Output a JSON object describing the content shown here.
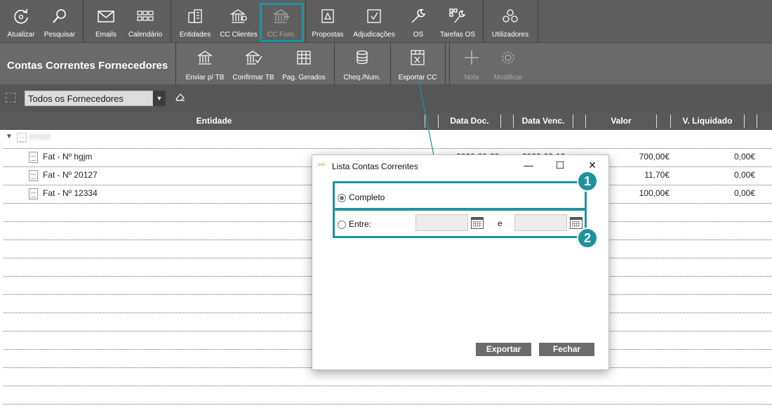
{
  "toolbar": {
    "atualizar": "Atualizar",
    "pesquisar": "Pesquisar",
    "emails": "Emails",
    "calendario": "Calendário",
    "entidades": "Entidades",
    "cc_clientes": "CC Clientes",
    "cc_forn": "CC Forn.",
    "propostas": "Propostas",
    "adjudicacoes": "Adjudicações",
    "os": "OS",
    "tarefas_os": "Tarefas OS",
    "utilizadores": "Utilizadores"
  },
  "subbar": {
    "title": "Contas Correntes Fornecedores",
    "enviar": "Enviar p/ TB",
    "confirmar": "Confirmar TB",
    "pag_gerados": "Pag. Gerados",
    "cheq_num": "Cheq./Num.",
    "exportar_cc": "Exportar CC",
    "nota": "Nota",
    "modificar": "Modificar"
  },
  "filter": {
    "selected": "Todos os Fornecedores"
  },
  "table": {
    "headers": [
      "Entidade",
      "Data Doc.",
      "Data Venc.",
      "Valor",
      "V. Liquidado"
    ],
    "group_label": "PTGP",
    "rows": [
      {
        "doc": "Fat  - Nº hgjm",
        "data_doc": "2020-09-09",
        "data_venc": "2020-09-10",
        "valor": "700,00€",
        "liquidado": "0,00€"
      },
      {
        "doc": "Fat  - Nº 20127",
        "data_doc": "",
        "data_venc": "",
        "valor": "11,70€",
        "liquidado": "0,00€"
      },
      {
        "doc": "Fat  - Nº 12334",
        "data_doc": "",
        "data_venc": "",
        "valor": "100,00€",
        "liquidado": "0,00€"
      }
    ]
  },
  "dialog": {
    "title": "Lista Contas Correntes",
    "option_completo": "Completo",
    "option_entre": "Entre:",
    "between_word": "e",
    "btn_exportar": "Exportar",
    "btn_fechar": "Fechar",
    "badge1": "1",
    "badge2": "2"
  },
  "colors": {
    "highlight": "#1e93a0",
    "toolbar_bg": "#5f5f5f"
  }
}
